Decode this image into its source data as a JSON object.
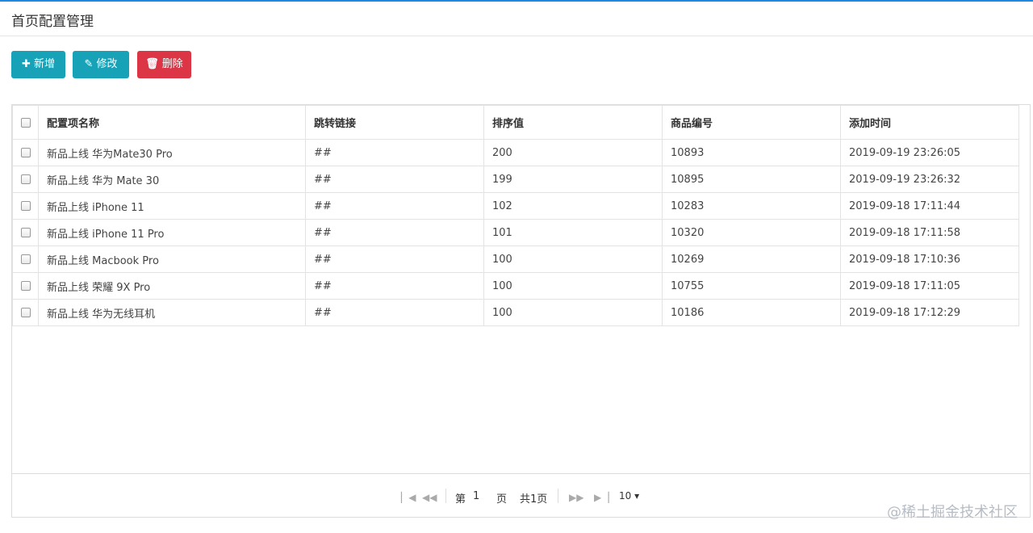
{
  "page": {
    "title": "首页配置管理"
  },
  "toolbar": {
    "add_label": "新增",
    "edit_label": "修改",
    "delete_label": "删除",
    "add_icon": "plus-icon",
    "edit_icon": "edit-icon",
    "delete_icon": "trash-icon",
    "primary_color": "#17a2b8",
    "danger_color": "#dc3545"
  },
  "table": {
    "columns": [
      "配置项名称",
      "跳转链接",
      "排序值",
      "商品编号",
      "添加时间"
    ],
    "rows": [
      [
        "新品上线 华为Mate30 Pro",
        "##",
        "200",
        "10893",
        "2019-09-19 23:26:05"
      ],
      [
        "新品上线 华为 Mate 30",
        "##",
        "199",
        "10895",
        "2019-09-19 23:26:32"
      ],
      [
        "新品上线 iPhone 11",
        "##",
        "102",
        "10283",
        "2019-09-18 17:11:44"
      ],
      [
        "新品上线 iPhone 11 Pro",
        "##",
        "101",
        "10320",
        "2019-09-18 17:11:58"
      ],
      [
        "新品上线 Macbook Pro",
        "##",
        "100",
        "10269",
        "2019-09-18 17:10:36"
      ],
      [
        "新品上线 荣耀 9X Pro",
        "##",
        "100",
        "10755",
        "2019-09-18 17:11:05"
      ],
      [
        "新品上线 华为无线耳机",
        "##",
        "100",
        "10186",
        "2019-09-18 17:12:29"
      ]
    ]
  },
  "pager": {
    "page_prefix": "第",
    "current_page": "1",
    "page_suffix": "页",
    "total_text": "共1页",
    "page_size": "10"
  },
  "watermark": "@稀土掘金技术社区"
}
